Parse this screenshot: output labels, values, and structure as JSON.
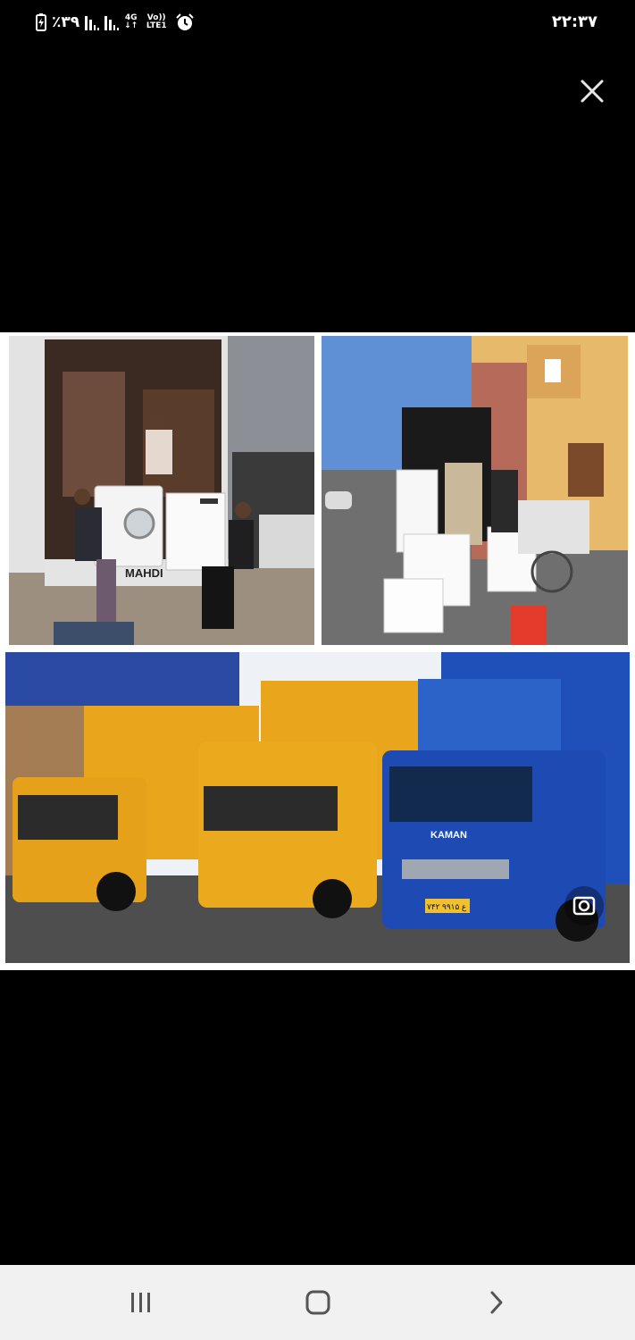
{
  "status_bar": {
    "battery_percent": "٪۳۹",
    "network_type": "4G",
    "volte_label": "Vo)) LTE1",
    "time": "۲۲:۳۷"
  },
  "viewer": {
    "truck_texts": {
      "mahdi": "MAHDI",
      "kaman": "KAMAN",
      "plate": "۷۴۲ ع ۹۹۱۵"
    }
  },
  "colors": {
    "background": "#000000",
    "navbar": "#f1f1f1",
    "truck_yellow": "#e9a51c",
    "truck_blue": "#1f4fb8"
  }
}
